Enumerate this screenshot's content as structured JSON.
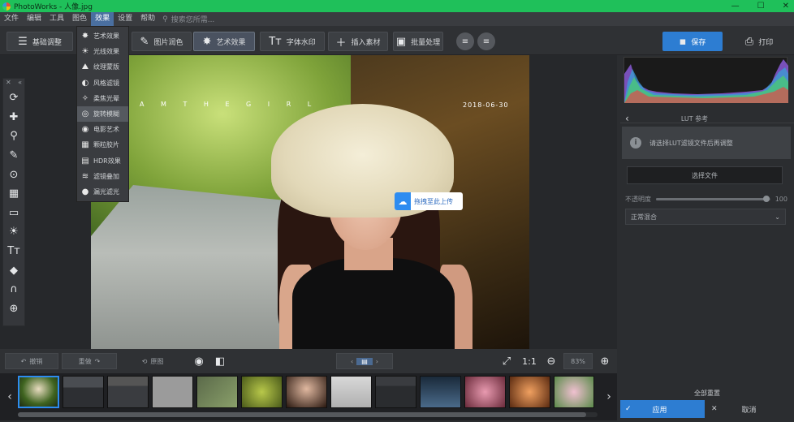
{
  "window": {
    "title": "PhotoWorks - 人像.jpg"
  },
  "menubar": {
    "items": [
      "文件",
      "编辑",
      "工具",
      "图色",
      "效果",
      "设置",
      "帮助"
    ],
    "active_index": 4,
    "search_placeholder": "搜索您所需..."
  },
  "toolbar": {
    "buttons": [
      "基础调整",
      "图片润色",
      "艺术效果",
      "字体水印",
      "插入素材",
      "批量处理"
    ],
    "active": "艺术效果",
    "save_label": "保存",
    "print_label": "打印"
  },
  "effects_menu": {
    "items": [
      "艺术效果",
      "光线效果",
      "纹理蒙版",
      "风格滤镜",
      "柔焦光晕",
      "旋转模糊",
      "电影艺术",
      "颗粒胶片",
      "HDR效果",
      "滤镜叠加",
      "漏光滤光"
    ],
    "highlighted_index": 5
  },
  "photo": {
    "overlay_text": "A M T H E G I R L",
    "overlay_date": "2018-06-30"
  },
  "upload_tip": {
    "label": "拖拽至此上传"
  },
  "bottombar": {
    "undo_label": "撤销",
    "redo_label": "重做",
    "reset_label": "原图",
    "ratio_label": "1:1",
    "zoom_value": "83%"
  },
  "filmstrip": {
    "count": 13,
    "selected_index": 0
  },
  "right_panel": {
    "section_title": "LUT 参考",
    "info_text": "请选择LUT滤镜文件后再调整",
    "select_button": "选择文件",
    "slider_label": "不透明度",
    "slider_value": "100",
    "slider_fraction": 0.97,
    "dropdown_value": "正常混合",
    "reset_label": "全部重置",
    "apply_label": "应用",
    "cancel_label": "取消"
  }
}
